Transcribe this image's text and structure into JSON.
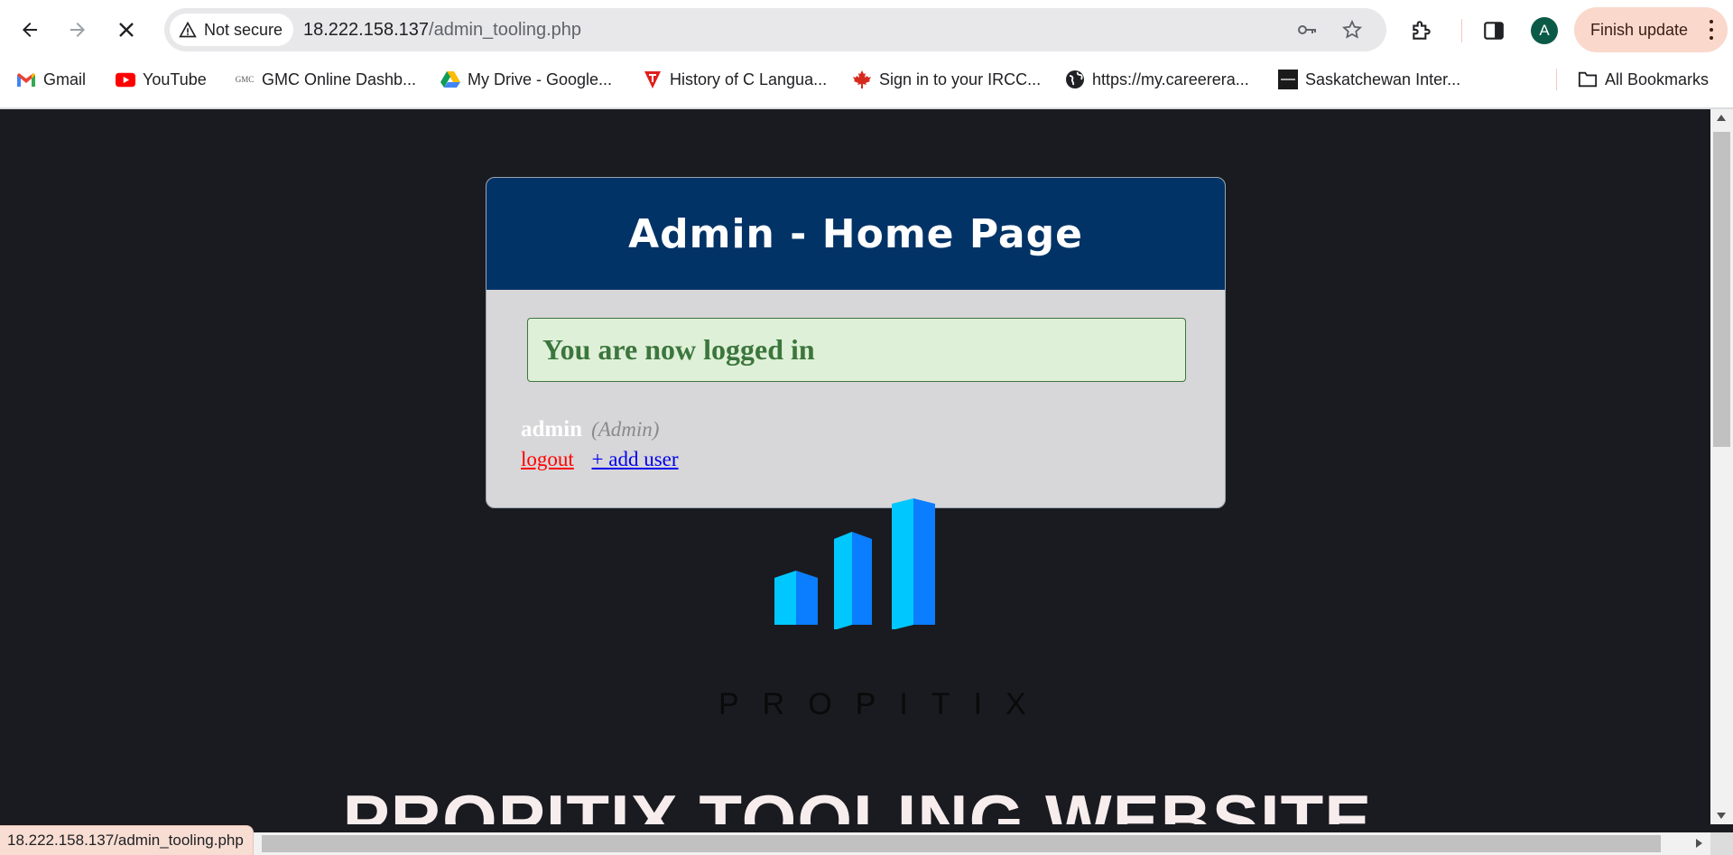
{
  "browser": {
    "security_label": "Not secure",
    "url_host": "18.222.158.137",
    "url_path": "/admin_tooling.php",
    "avatar_initial": "A",
    "update_label": "Finish update",
    "status_url": "18.222.158.137/admin_tooling.php"
  },
  "bookmarks": {
    "items": [
      {
        "label": "Gmail",
        "icon": "gmail-icon"
      },
      {
        "label": "YouTube",
        "icon": "youtube-icon"
      },
      {
        "label": "GMC Online Dashb...",
        "icon": "gmc-icon",
        "icon_text": "GMC"
      },
      {
        "label": "My Drive - Google...",
        "icon": "google-drive-icon"
      },
      {
        "label": "History of C Langua...",
        "icon": "tutorial-icon"
      },
      {
        "label": "Sign in to your IRCC...",
        "icon": "maple-leaf-icon"
      },
      {
        "label": "https://my.careerera...",
        "icon": "globe-icon"
      },
      {
        "label": "Saskatchewan Inter...",
        "icon": "saskatchewan-icon"
      }
    ],
    "all_label": "All Bookmarks"
  },
  "page": {
    "card_title": "Admin - Home Page",
    "alert_text": "You are now logged in",
    "username": "admin",
    "role": "(Admin)",
    "logout_label": "logout",
    "add_user_label": "+ add user",
    "brand_name": "PROPITIX",
    "site_title": "PROPITIX TOOLING WEBSITE"
  },
  "colors": {
    "card_header": "#013366",
    "alert_bg": "#dff0d8",
    "alert_text": "#3c763d",
    "logout": "#ff0000",
    "link": "#0000ee",
    "page_bg": "#1a1b20",
    "logo_cyan": "#00c8ff",
    "logo_blue": "#0b7dff"
  }
}
